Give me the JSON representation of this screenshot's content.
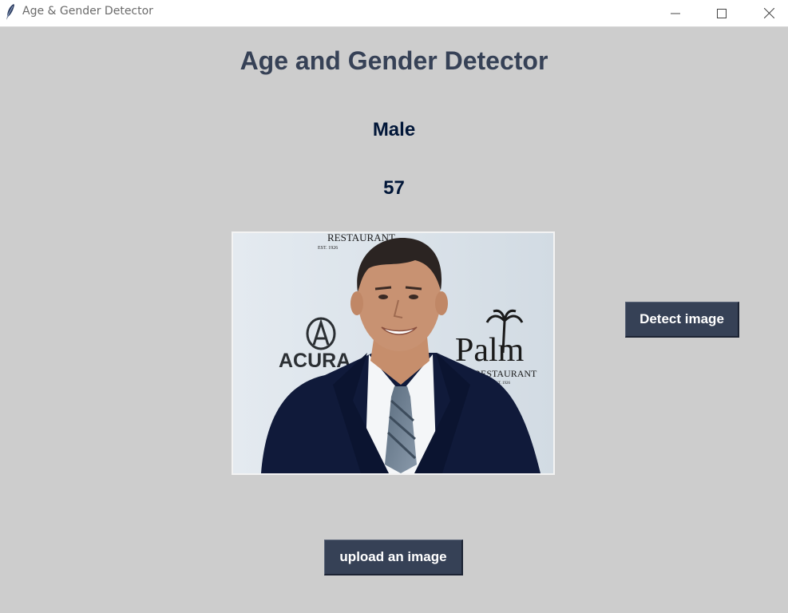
{
  "window": {
    "title": "Age & Gender Detector",
    "controls": [
      "minimize",
      "maximize",
      "close"
    ]
  },
  "main": {
    "heading": "Age and Gender Detector",
    "gender_label": "Male",
    "age_label": "57"
  },
  "photo": {
    "texts": {
      "top_logo": "RESTAURANT",
      "top_logo_sub": "EST. 1926",
      "left_logo": "ACURA",
      "right_logo": "Palm",
      "right_logo_sub": "RESTAURANT",
      "right_logo_est": "EST. 1926"
    }
  },
  "buttons": {
    "detect": "Detect image",
    "upload": "upload an image"
  },
  "colors": {
    "background": "#cdcdcd",
    "button_bg": "#364156",
    "heading": "#364156",
    "label": "#011638"
  }
}
